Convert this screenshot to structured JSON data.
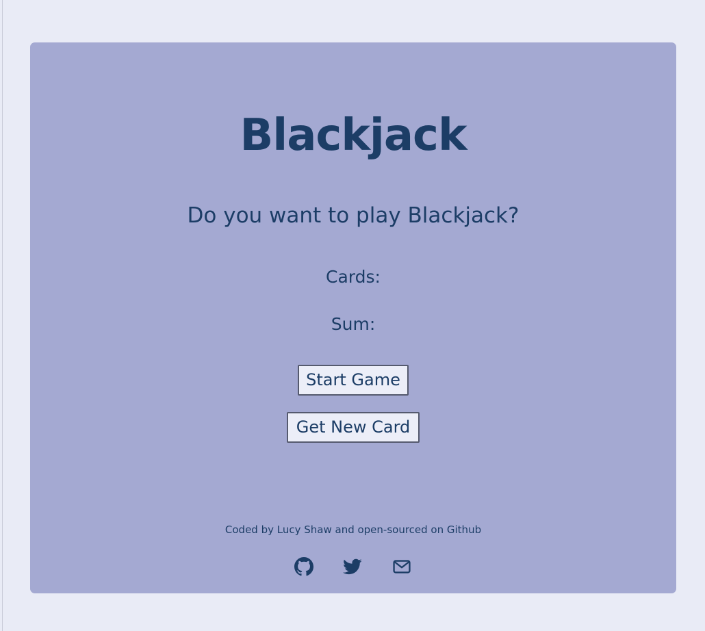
{
  "header": {
    "title": "Blackjack"
  },
  "game": {
    "message": "Do you want to play Blackjack?",
    "cards_label": "Cards:",
    "sum_label": "Sum:"
  },
  "buttons": {
    "start_label": "Start Game",
    "new_card_label": "Get New Card"
  },
  "footer": {
    "credit": "Coded by Lucy Shaw and open-sourced on Github",
    "icons": [
      "github-icon",
      "twitter-icon",
      "mail-icon"
    ]
  },
  "colors": {
    "page_background": "#e9ebf6",
    "card_background": "#a4a9d2",
    "text": "#1c3d66",
    "button_background": "#eceef8"
  }
}
